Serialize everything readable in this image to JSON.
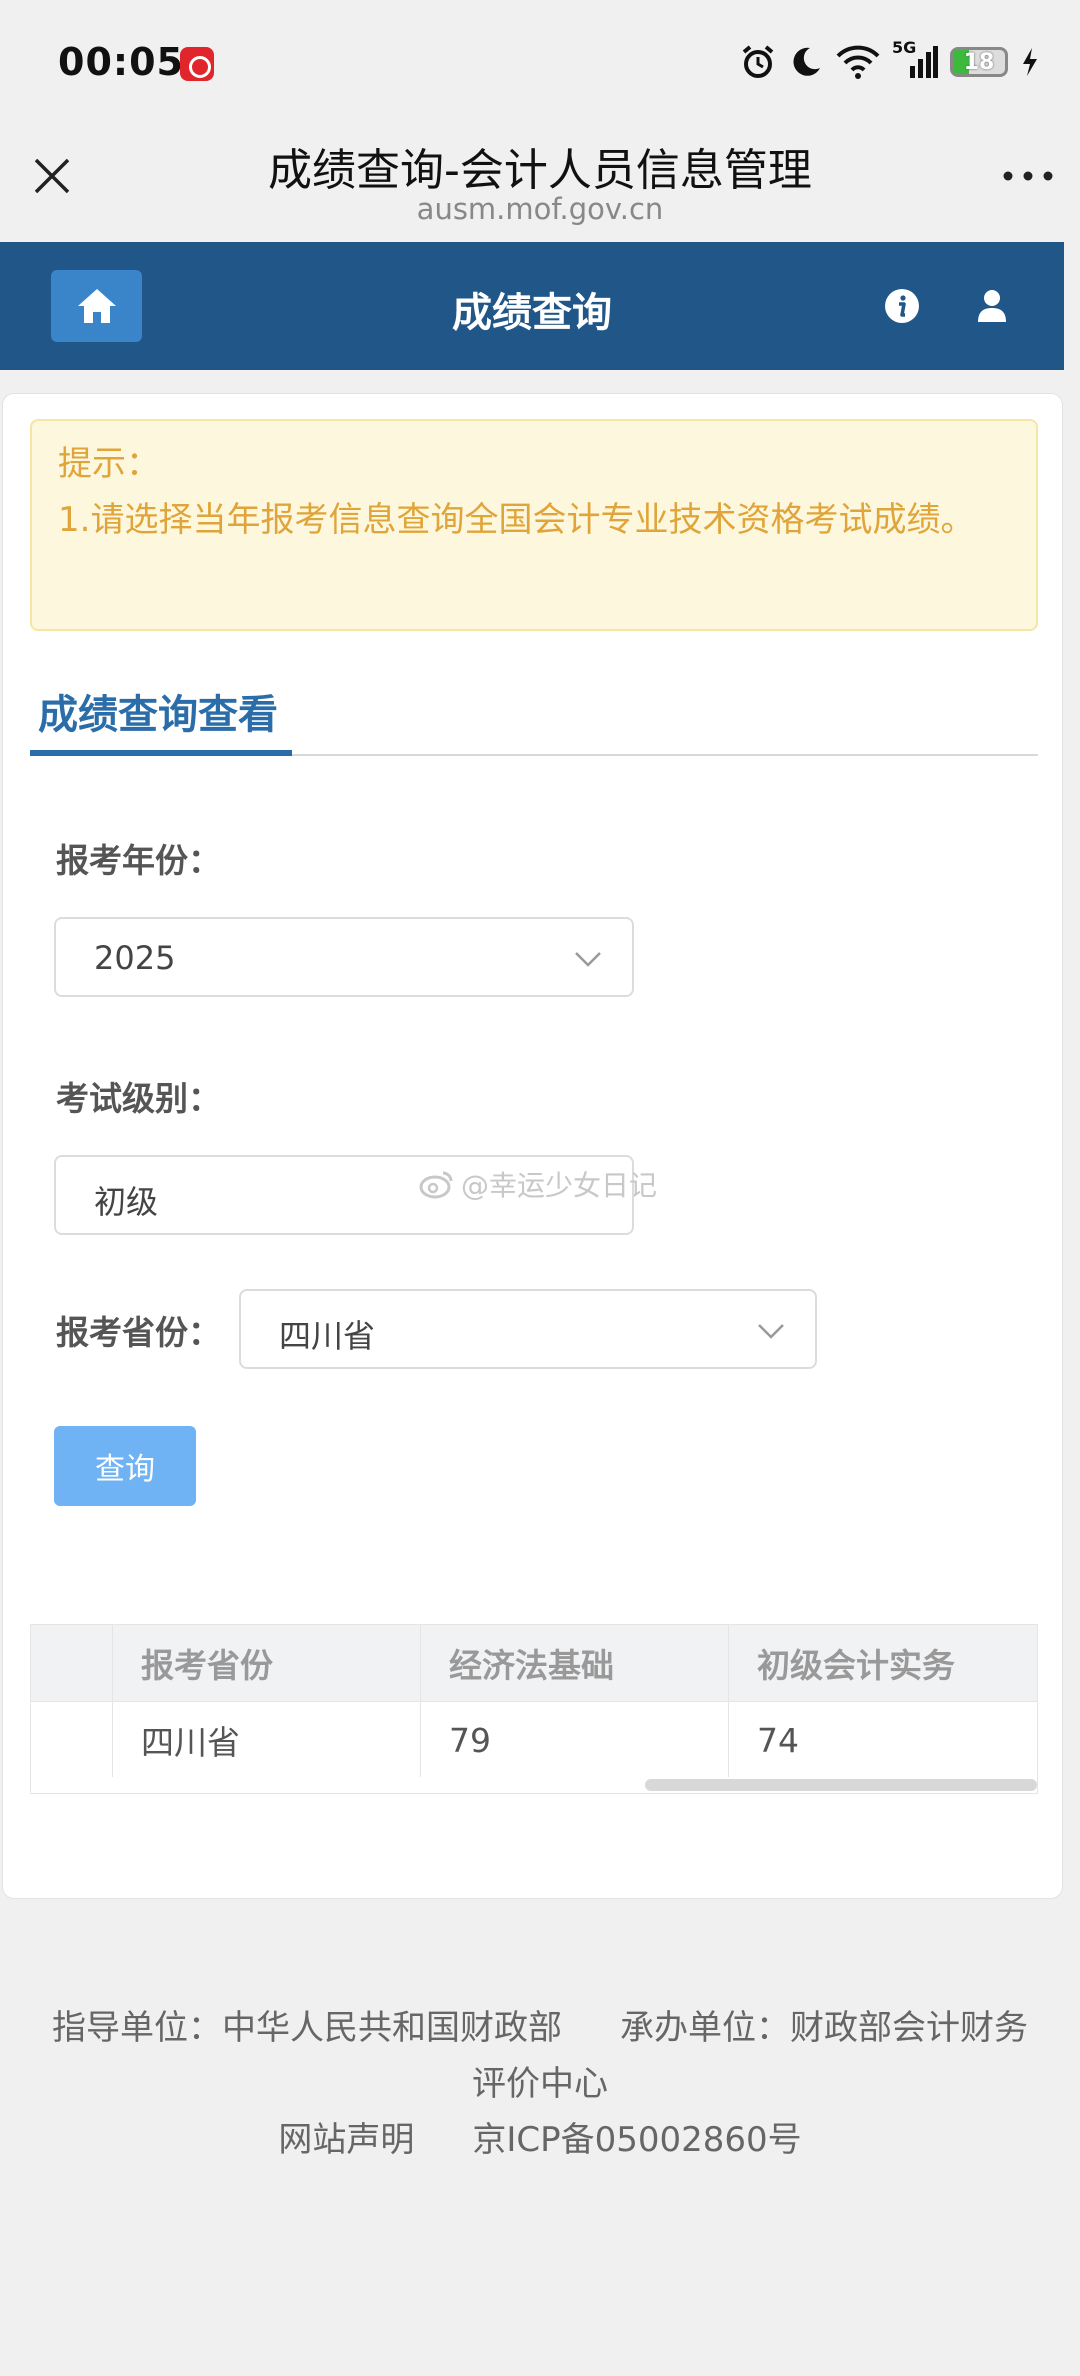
{
  "status_bar": {
    "time": "00:05",
    "network": "5G",
    "battery": "18"
  },
  "browser": {
    "title": "成绩查询-会计人员信息管理",
    "url": "ausm.mof.gov.cn"
  },
  "app_bar": {
    "title": "成绩查询"
  },
  "notice": {
    "title": "提示：",
    "body": "1.请选择当年报考信息查询全国会计专业技术资格考试成绩。"
  },
  "tab": {
    "label": "成绩查询查看"
  },
  "form": {
    "year_label": "报考年份：",
    "year_value": "2025",
    "level_label": "考试级别：",
    "level_value": "初级",
    "province_label": "报考省份：",
    "province_value": "四川省",
    "query_button": "查询"
  },
  "watermark": "@幸运少女日记",
  "table": {
    "headers": [
      "",
      "报考省份",
      "经济法基础",
      "初级会计实务"
    ],
    "rows": [
      [
        "",
        "四川省",
        "79",
        "74"
      ]
    ]
  },
  "footer": {
    "guide_unit": "指导单位：中华人民共和国财政部",
    "host_unit_a": "承办单位：财政部会计财务",
    "host_unit_b": "评价中心",
    "statement": "网站声明",
    "icp": "京ICP备05002860号"
  },
  "colors": {
    "app_bar": "#215688",
    "home_button": "#3a84c9",
    "tab_accent": "#2a6da8",
    "notice_text": "#e0a53a",
    "query_button": "#6fb3f5"
  }
}
